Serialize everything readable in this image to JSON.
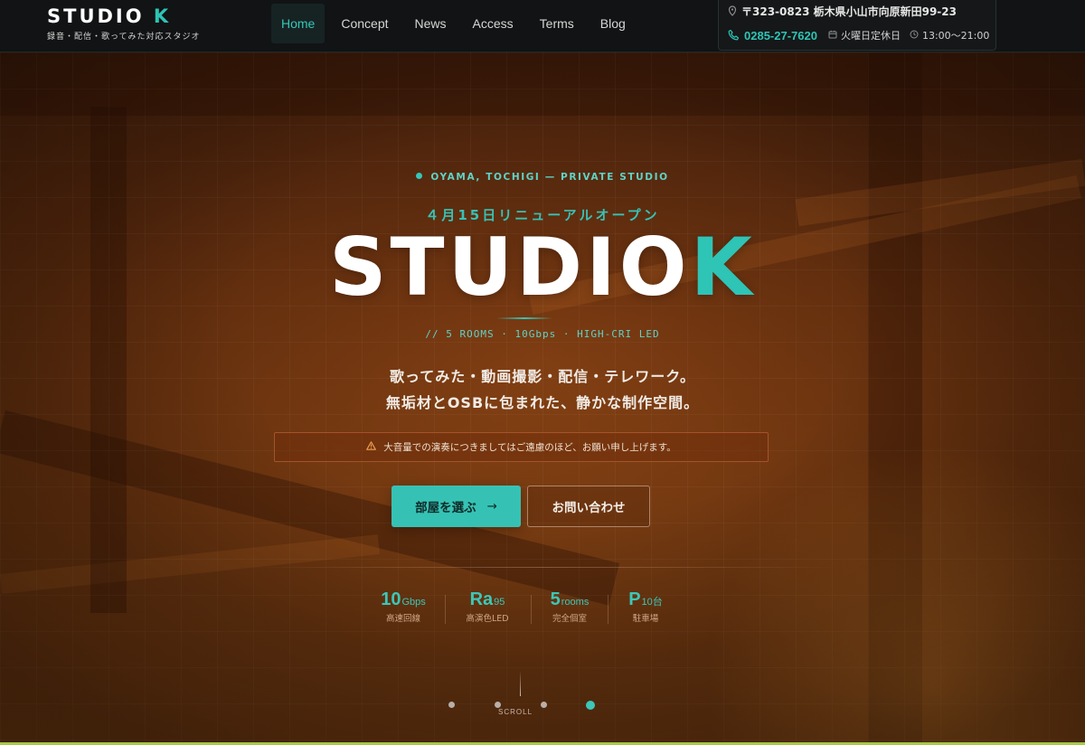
{
  "header": {
    "logo_main": "STUDIO",
    "logo_accent": "K",
    "logo_sub": "録音・配信・歌ってみた対応スタジオ",
    "nav": [
      {
        "label": "Home",
        "active": true
      },
      {
        "label": "Concept",
        "active": false
      },
      {
        "label": "News",
        "active": false
      },
      {
        "label": "Access",
        "active": false
      },
      {
        "label": "Terms",
        "active": false
      },
      {
        "label": "Blog",
        "active": false
      }
    ],
    "info": {
      "address": "〒323-0823 栃木県小山市向原新田99-23",
      "phone": "0285-27-7620",
      "closed": "火曜日定休日",
      "hours": "13:00〜21:00",
      "icons": [
        "map-pin-icon",
        "phone-icon",
        "calendar-icon",
        "clock-icon"
      ]
    }
  },
  "hero": {
    "eyebrow": "OYAMA, TOCHIGI — PRIVATE STUDIO",
    "renewal": "４月15日リニューアルオープン",
    "title_main": "STUDIO",
    "title_accent": "K",
    "specs": "// 5 ROOMS · 10Gbps · HIGH-CRI LED",
    "lead1": "歌ってみた・動画撮影・配信・テレワーク。",
    "lead2": "無垢材とOSBに包まれた、静かな制作空間。",
    "notice": "大音量での演奏につきましてはご遠慮のほど、お願い申し上げます。",
    "primary_button": "部屋を選ぶ",
    "primary_arrow": "→",
    "secondary_button": "お問い合わせ",
    "stats": [
      {
        "value": "10",
        "unit": "Gbps",
        "label": "高速回線"
      },
      {
        "value": "Ra",
        "unit": "95",
        "label": "高演色LED"
      },
      {
        "value": "5",
        "unit": "rooms",
        "label": "完全個室"
      },
      {
        "value": "P",
        "unit": "10台",
        "label": "駐車場"
      }
    ],
    "scroll_label": "SCROLL",
    "slides_total": 4,
    "slide_active": 4
  },
  "colors": {
    "accent": "#2ec4b6",
    "header_bg": "#111314",
    "warning_border": "#a3542a"
  }
}
